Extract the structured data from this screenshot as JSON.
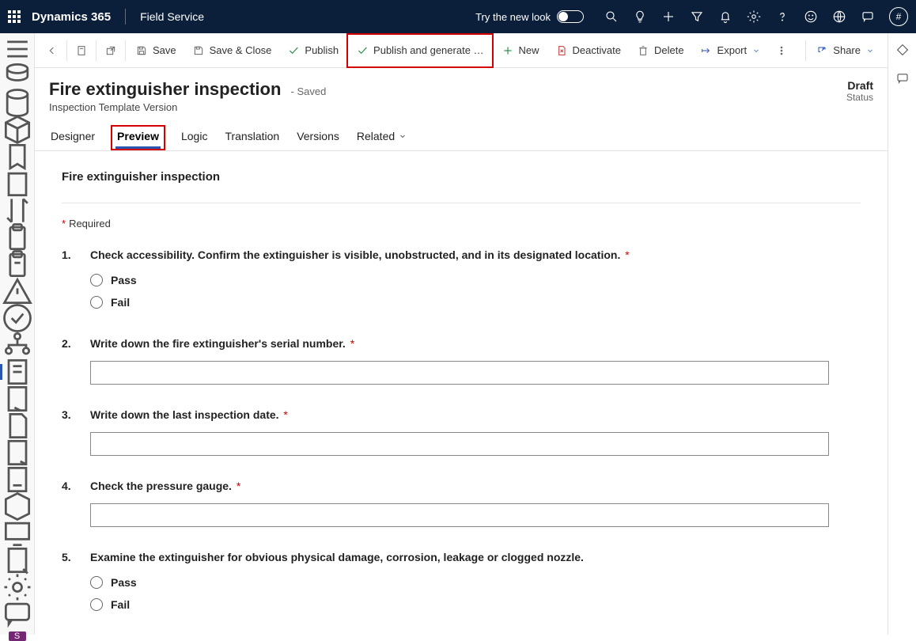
{
  "topbar": {
    "brand": "Dynamics 365",
    "app": "Field Service",
    "try_new_look": "Try the new look"
  },
  "cmdbar": {
    "save": "Save",
    "save_close": "Save & Close",
    "publish": "Publish",
    "publish_gen": "Publish and generate …",
    "new": "New",
    "deactivate": "Deactivate",
    "delete": "Delete",
    "export": "Export",
    "share": "Share"
  },
  "record": {
    "title": "Fire extinguisher inspection",
    "saved": "- Saved",
    "subtitle": "Inspection Template Version",
    "status_value": "Draft",
    "status_label": "Status"
  },
  "tabs": {
    "designer": "Designer",
    "preview": "Preview",
    "logic": "Logic",
    "translation": "Translation",
    "versions": "Versions",
    "related": "Related"
  },
  "preview": {
    "heading": "Fire extinguisher inspection",
    "required": "Required",
    "questions": [
      {
        "num": "1.",
        "text": "Check accessibility. Confirm the extinguisher is visible, unobstructed, and in its designated location.",
        "required": true,
        "type": "radio",
        "options": [
          "Pass",
          "Fail"
        ]
      },
      {
        "num": "2.",
        "text": "Write down the fire extinguisher's serial number.",
        "required": true,
        "type": "text"
      },
      {
        "num": "3.",
        "text": "Write down the last inspection date.",
        "required": true,
        "type": "text"
      },
      {
        "num": "4.",
        "text": "Check the pressure gauge.",
        "required": true,
        "type": "text"
      },
      {
        "num": "5.",
        "text": "Examine the extinguisher for obvious physical damage, corrosion, leakage or clogged nozzle.",
        "required": false,
        "type": "radio",
        "options": [
          "Pass",
          "Fail"
        ]
      }
    ]
  },
  "sidebar_badge": "S"
}
